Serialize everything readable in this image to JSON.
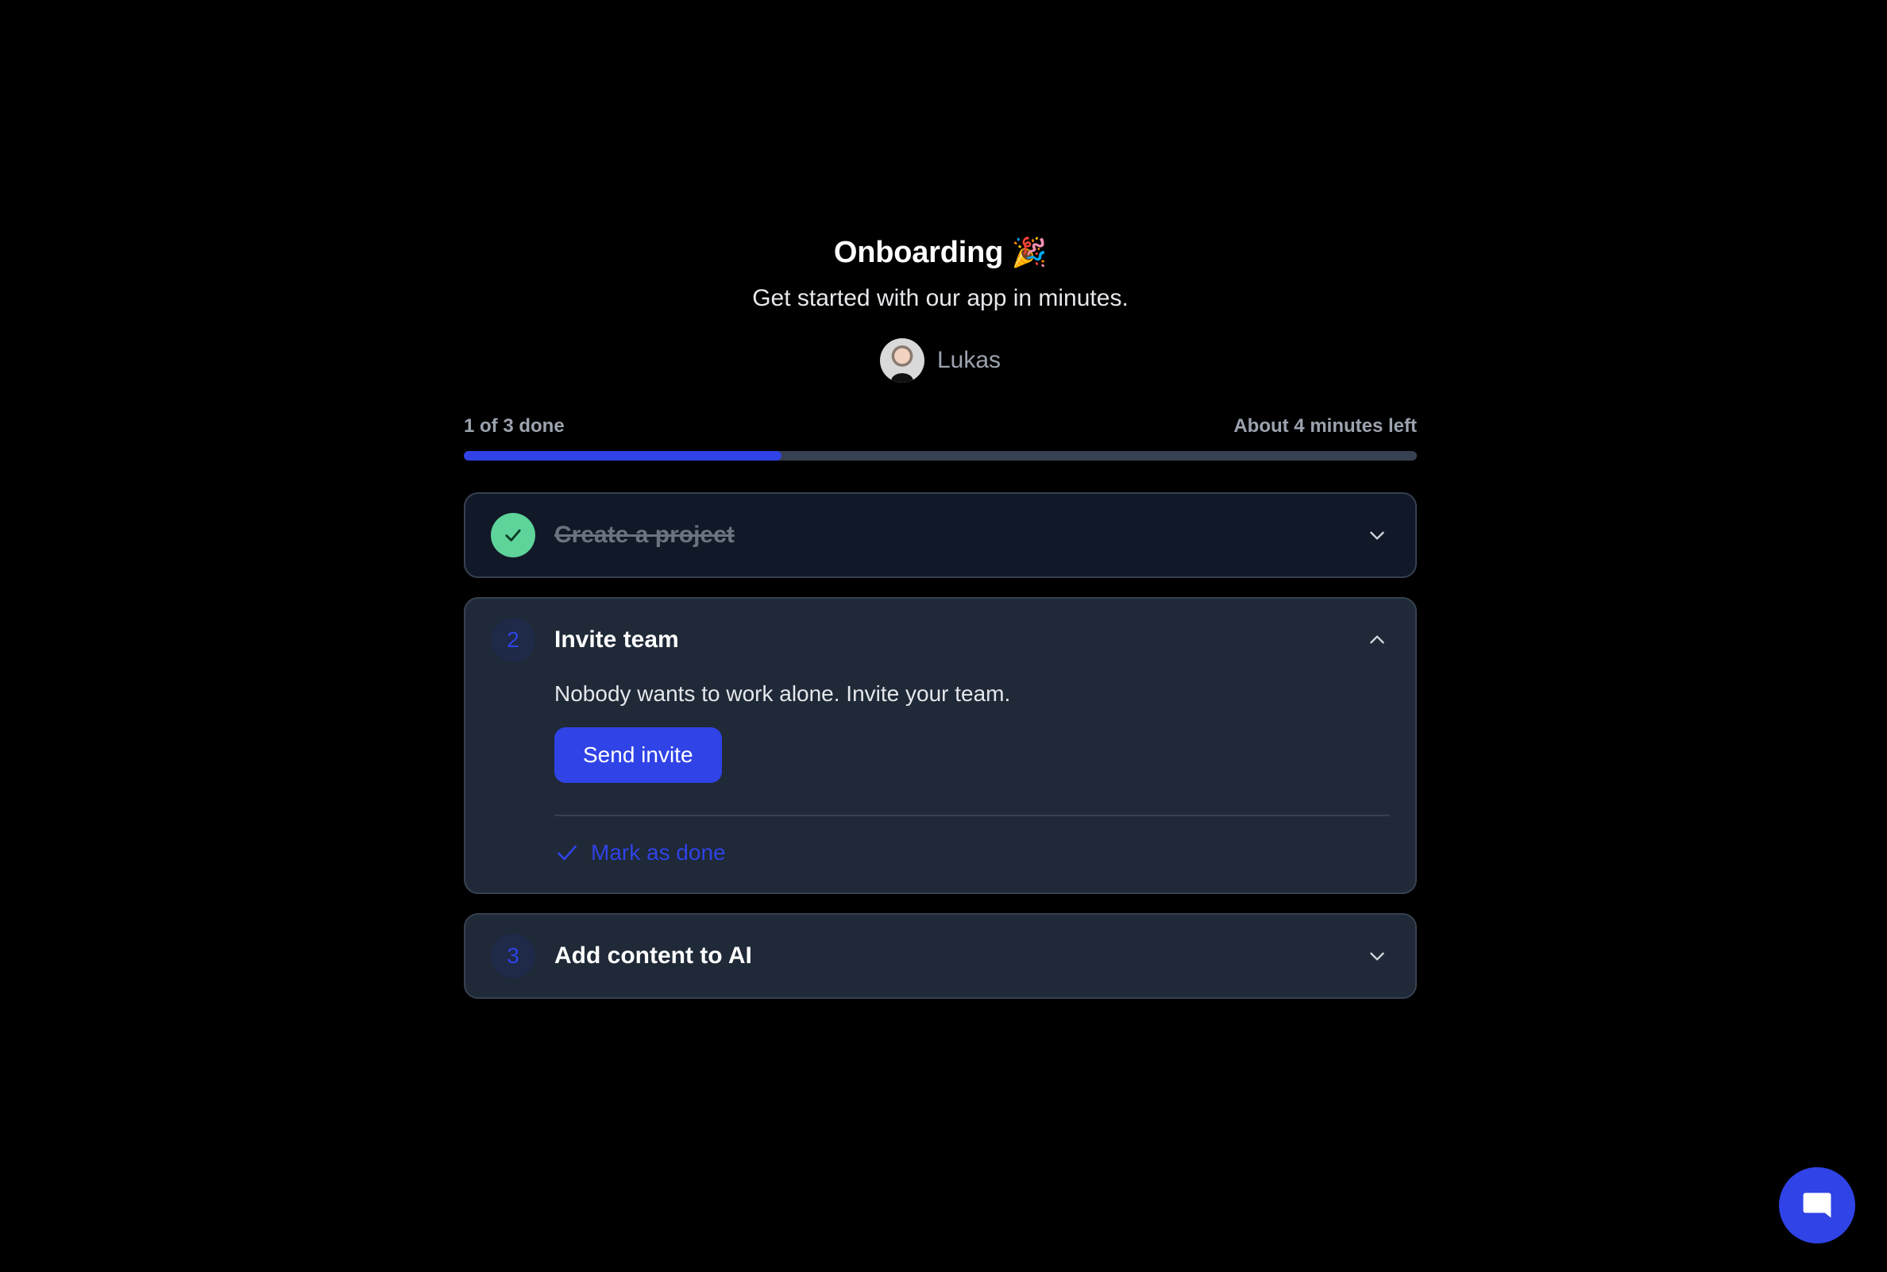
{
  "header": {
    "title": "Onboarding",
    "title_emoji": "🎉",
    "subtitle": "Get started with our app in minutes.",
    "author_name": "Lukas"
  },
  "progress": {
    "done_label": "1 of 3 done",
    "time_left_label": "About 4 minutes left",
    "fraction": 0.333
  },
  "steps": [
    {
      "number": "1",
      "title": "Create a project",
      "status": "done",
      "expanded": false
    },
    {
      "number": "2",
      "title": "Invite team",
      "status": "active",
      "expanded": true,
      "description": "Nobody wants to work alone. Invite your team.",
      "button_label": "Send invite",
      "mark_done_label": "Mark as done"
    },
    {
      "number": "3",
      "title": "Add content to AI",
      "status": "todo",
      "expanded": false
    }
  ],
  "icons": {
    "completed": "check-icon",
    "collapsed": "chevron-down-icon",
    "expanded": "chevron-up-icon",
    "mark_done": "check-icon",
    "chat": "chat-bubble-icon"
  },
  "colors": {
    "accent": "#2f43e6",
    "success": "#5ed39a",
    "background": "#000000",
    "card": "#1f2937"
  }
}
